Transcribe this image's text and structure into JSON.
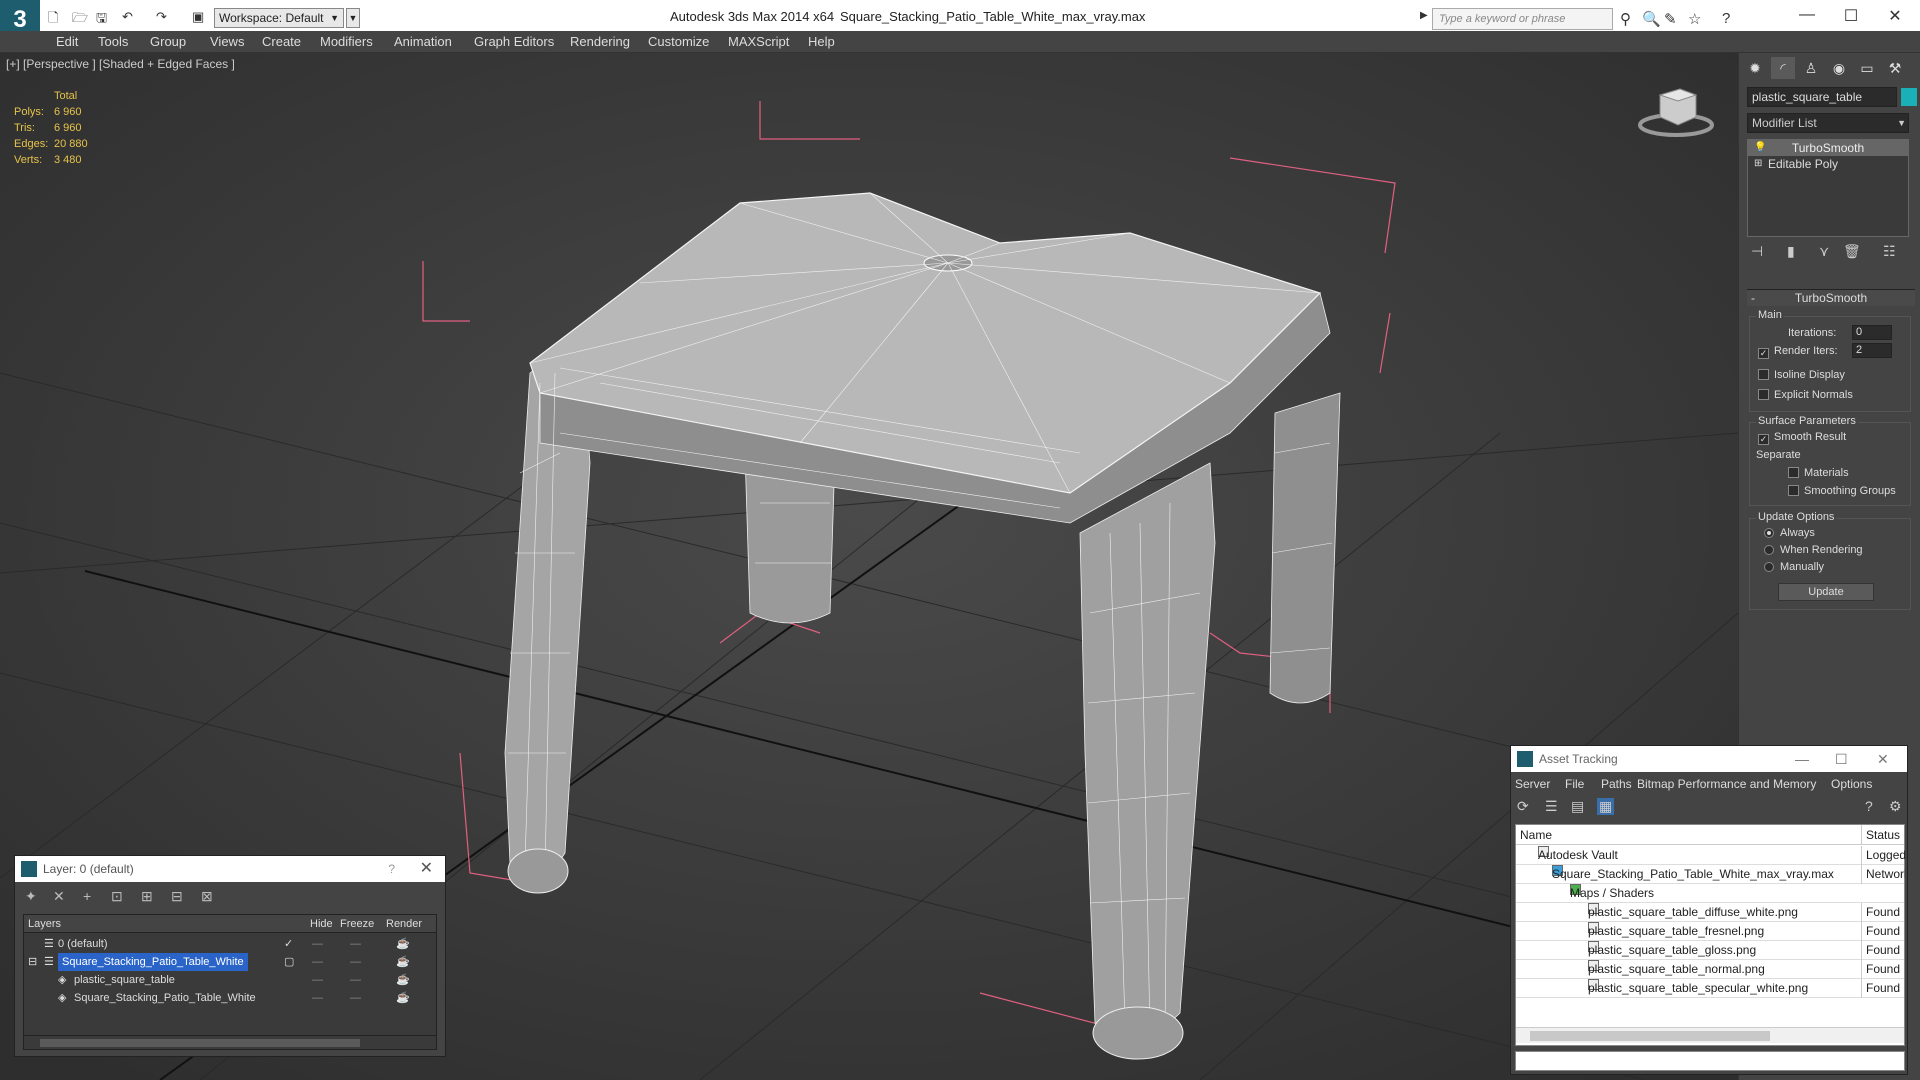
{
  "titlebar": {
    "workspace": "Workspace: Default",
    "app_title": "Autodesk 3ds Max  2014 x64",
    "file_title": "Square_Stacking_Patio_Table_White_max_vray.max",
    "search_placeholder": "Type a keyword or phrase"
  },
  "menu": [
    "Edit",
    "Tools",
    "Group",
    "Views",
    "Create",
    "Modifiers",
    "Animation",
    "Graph Editors",
    "Rendering",
    "Customize",
    "MAXScript",
    "Help"
  ],
  "viewport": {
    "label": "[+] [Perspective ] [Shaded + Edged Faces ]",
    "stats": {
      "header": "Total",
      "polys_label": "Polys:",
      "polys": "6 960",
      "tris_label": "Tris:",
      "tris": "6 960",
      "edges_label": "Edges:",
      "edges": "20 880",
      "verts_label": "Verts:",
      "verts": "3 480"
    }
  },
  "command_panel": {
    "object_name": "plastic_square_table",
    "object_color": "#1ab0b8",
    "modifier_list": "Modifier List",
    "stack": [
      "TurboSmooth",
      "Editable Poly"
    ],
    "rollout_title": "TurboSmooth",
    "main_label": "Main",
    "iterations_label": "Iterations:",
    "iterations": "0",
    "render_iters_label": "Render Iters:",
    "render_iters": "2",
    "isoline": "Isoline Display",
    "explicit_normals": "Explicit Normals",
    "surface_params": "Surface Parameters",
    "smooth_result": "Smooth Result",
    "separate": "Separate",
    "materials": "Materials",
    "smoothing_groups": "Smoothing Groups",
    "update_options": "Update Options",
    "always": "Always",
    "when_rendering": "When Rendering",
    "manually": "Manually",
    "update_button": "Update"
  },
  "layer_window": {
    "title": "Layer: 0 (default)",
    "help": "?",
    "col_layers": "Layers",
    "col_hide": "Hide",
    "col_freeze": "Freeze",
    "col_render": "Render",
    "rows": [
      "0 (default)",
      "Square_Stacking_Patio_Table_White",
      "plastic_square_table",
      "Square_Stacking_Patio_Table_White"
    ]
  },
  "asset_window": {
    "title": "Asset Tracking",
    "menu": [
      "Server",
      "File",
      "Paths",
      "Bitmap Performance and Memory",
      "Options"
    ],
    "col_name": "Name",
    "col_status": "Status",
    "rows": [
      {
        "name": "Autodesk Vault",
        "status": "Logged O"
      },
      {
        "name": "Square_Stacking_Patio_Table_White_max_vray.max",
        "status": "Network"
      },
      {
        "name": "Maps / Shaders",
        "status": ""
      },
      {
        "name": "plastic_square_table_diffuse_white.png",
        "status": "Found"
      },
      {
        "name": "plastic_square_table_fresnel.png",
        "status": "Found"
      },
      {
        "name": "plastic_square_table_gloss.png",
        "status": "Found"
      },
      {
        "name": "plastic_square_table_normal.png",
        "status": "Found"
      },
      {
        "name": "plastic_square_table_specular_white.png",
        "status": "Found"
      }
    ]
  }
}
